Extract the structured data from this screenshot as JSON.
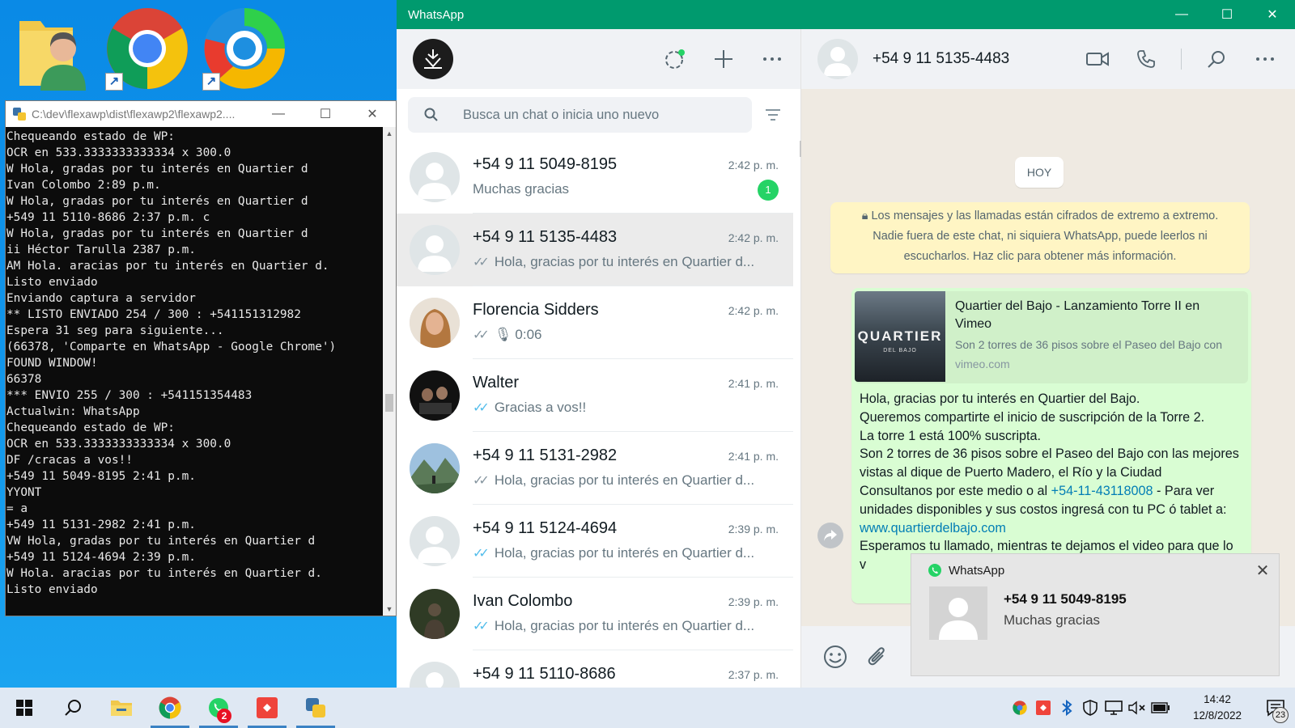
{
  "desktop": {
    "icons": [
      {
        "name": "user-folder-icon"
      },
      {
        "name": "chrome-shortcut-icon"
      },
      {
        "name": "edge-shortcut-icon"
      }
    ]
  },
  "console": {
    "title": "C:\\dev\\flexawp\\dist\\flexawp2\\flexawp2....",
    "lines": [
      "Chequeando estado de WP:",
      "OCR en 533.3333333333334 x 300.0",
      "W Hola, gradas por tu interés en Quartier d",
      "Ivan Colombo 2:89 p.m.",
      "W Hola, gradas por tu interés en Quartier d",
      "+549 11 5110-8686 2:37 p.m. c",
      "W Hola, gradas por tu interés en Quartier d",
      "ii Héctor Tarulla 2387 p.m.",
      "AM Hola. aracias por tu interés en Quartier d.",
      "Listo enviado",
      "Enviando captura a servidor",
      "** LISTO ENVIADO 254 / 300 : +541151312982",
      "Espera 31 seg para siguiente...",
      "(66378, 'Comparte en WhatsApp - Google Chrome')",
      "FOUND WINDOW!",
      "66378",
      "*** ENVIO 255 / 300 : +541151354483",
      "Actualwin: WhatsApp",
      "Chequeando estado de WP:",
      "OCR en 533.3333333333334 x 300.0",
      "DF /cracas a vos!!",
      "+549 11 5049-8195 2:41 p.m.",
      "YYONT",
      "= a",
      "+549 11 5131-2982 2:41 p.m.",
      "VW Hola, gradas por tu interés en Quartier d",
      "+549 11 5124-4694 2:39 p.m.",
      "W Hola. aracias por tu interés en Quartier d.",
      "Listo enviado"
    ]
  },
  "whatsapp": {
    "window_title": "WhatsApp",
    "search_placeholder": "Busca un chat o inicia uno nuevo",
    "chats": [
      {
        "name": "+54 9 11 5049-8195",
        "time": "2:42 p. m.",
        "preview": "Muchas gracias",
        "ticks": "",
        "badge": "1",
        "avatar": "default"
      },
      {
        "name": "+54 9 11 5135-4483",
        "time": "2:42 p. m.",
        "preview": "Hola, gracias por tu interés en Quartier d...",
        "ticks": "grey",
        "badge": "",
        "avatar": "default",
        "selected": true
      },
      {
        "name": "Florencia Sidders",
        "time": "2:42 p. m.",
        "preview": "0:06",
        "ticks": "grey",
        "badge": "",
        "avatar": "photo-florencia",
        "voice": true
      },
      {
        "name": "Walter",
        "time": "2:41 p. m.",
        "preview": "Gracias a vos!!",
        "ticks": "read",
        "badge": "",
        "avatar": "photo-walter"
      },
      {
        "name": "+54 9 11 5131-2982",
        "time": "2:41 p. m.",
        "preview": "Hola, gracias por tu interés en Quartier d...",
        "ticks": "grey",
        "badge": "",
        "avatar": "photo-mountain"
      },
      {
        "name": "+54 9 11 5124-4694",
        "time": "2:39 p. m.",
        "preview": "Hola, gracias por tu interés en Quartier d...",
        "ticks": "read",
        "badge": "",
        "avatar": "default"
      },
      {
        "name": "Ivan Colombo",
        "time": "2:39 p. m.",
        "preview": "Hola, gracias por tu interés en Quartier d...",
        "ticks": "read",
        "badge": "",
        "avatar": "photo-ivan"
      },
      {
        "name": "+54 9 11 5110-8686",
        "time": "2:37 p. m.",
        "preview": "",
        "ticks": "",
        "badge": "",
        "avatar": "default"
      }
    ],
    "active_chat": {
      "name": "+54 9 11 5135-4483",
      "day_chip": "HOY",
      "encryption_notice": [
        "Los mensajes y las llamadas están cifrados de extremo a extremo.",
        "Nadie fuera de este chat, ni siquiera WhatsApp, puede leerlos ni",
        "escucharlos. Haz clic para obtener más información."
      ],
      "link_preview": {
        "title": "Quartier del Bajo - Lanzamiento Torre II en Vimeo",
        "description": "Son 2 torres de 36 pisos sobre el Paseo del Bajo con",
        "domain": "vimeo.com",
        "thumb_text": "QUARTIER",
        "thumb_sub": "DEL BAJO"
      },
      "message": {
        "line1": "Hola, gracias por tu interés en Quartier del Bajo.",
        "line2": "Queremos compartirte el inicio de suscripción de la Torre 2.",
        "line3": "La torre 1 está 100% suscripta.",
        "line4": "Son 2 torres de 36 pisos sobre el Paseo del Bajo con las mejores vistas al dique de Puerto Madero, el Río y la Ciudad",
        "line5_pre": "Consultanos por este medio o al ",
        "phone_link": "+54-11-43118008",
        "line5_post": " - Para ver unidades disponibles y sus costos ingresá con tu PC ó tablet a: ",
        "web_link": "www.quartierdelbajo.com",
        "line6": "Esperamos tu llamado, mientras te dejamos el video para que lo v"
      }
    }
  },
  "toast": {
    "app_name": "WhatsApp",
    "title": "+54 9 11 5049-8195",
    "message": "Muchas gracias"
  },
  "taskbar": {
    "whatsapp_badge": "2",
    "time": "14:42",
    "date": "12/8/2022",
    "notification_count": "23"
  }
}
